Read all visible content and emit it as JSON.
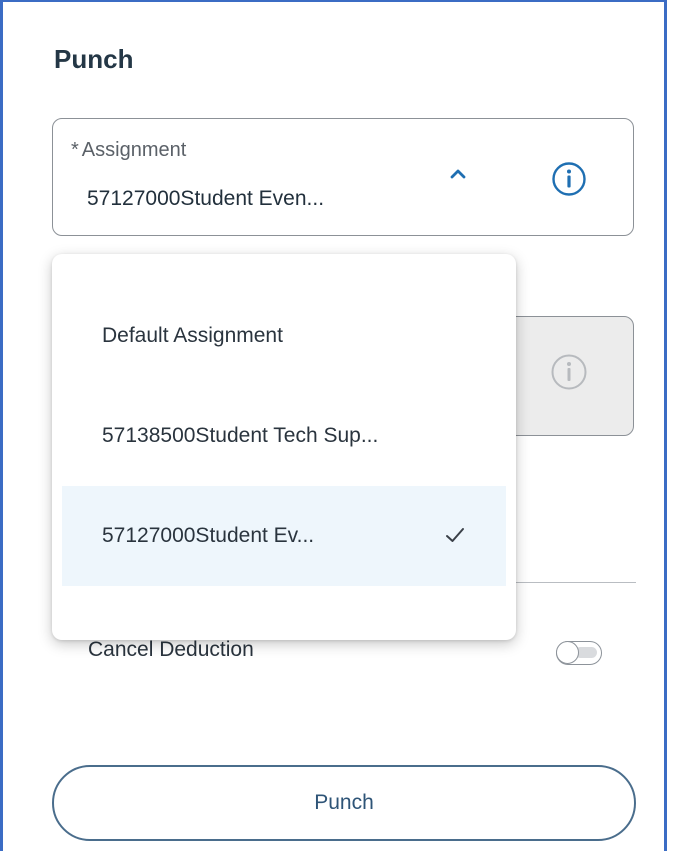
{
  "form": {
    "title": "Punch",
    "assignment": {
      "required_marker": "*",
      "label": "Assignment",
      "value": "57127000Student Even..."
    },
    "cancel_deduction": {
      "label": "Cancel Deduction",
      "enabled": false
    },
    "punch_button_label": "Punch"
  },
  "dropdown": {
    "options": [
      {
        "label": "Default Assignment",
        "selected": false
      },
      {
        "label": "57138500Student Tech Sup...",
        "selected": false
      },
      {
        "label": "57127000Student Ev...",
        "selected": true
      }
    ]
  },
  "icons": {
    "info": "info-icon",
    "chevron": "chevron-up-icon",
    "check": "check-icon"
  },
  "colors": {
    "accent": "#1f6fb2",
    "frame": "#3b6cc4",
    "selected_row": "#eef6fc",
    "button_border": "#4a6d8c"
  }
}
